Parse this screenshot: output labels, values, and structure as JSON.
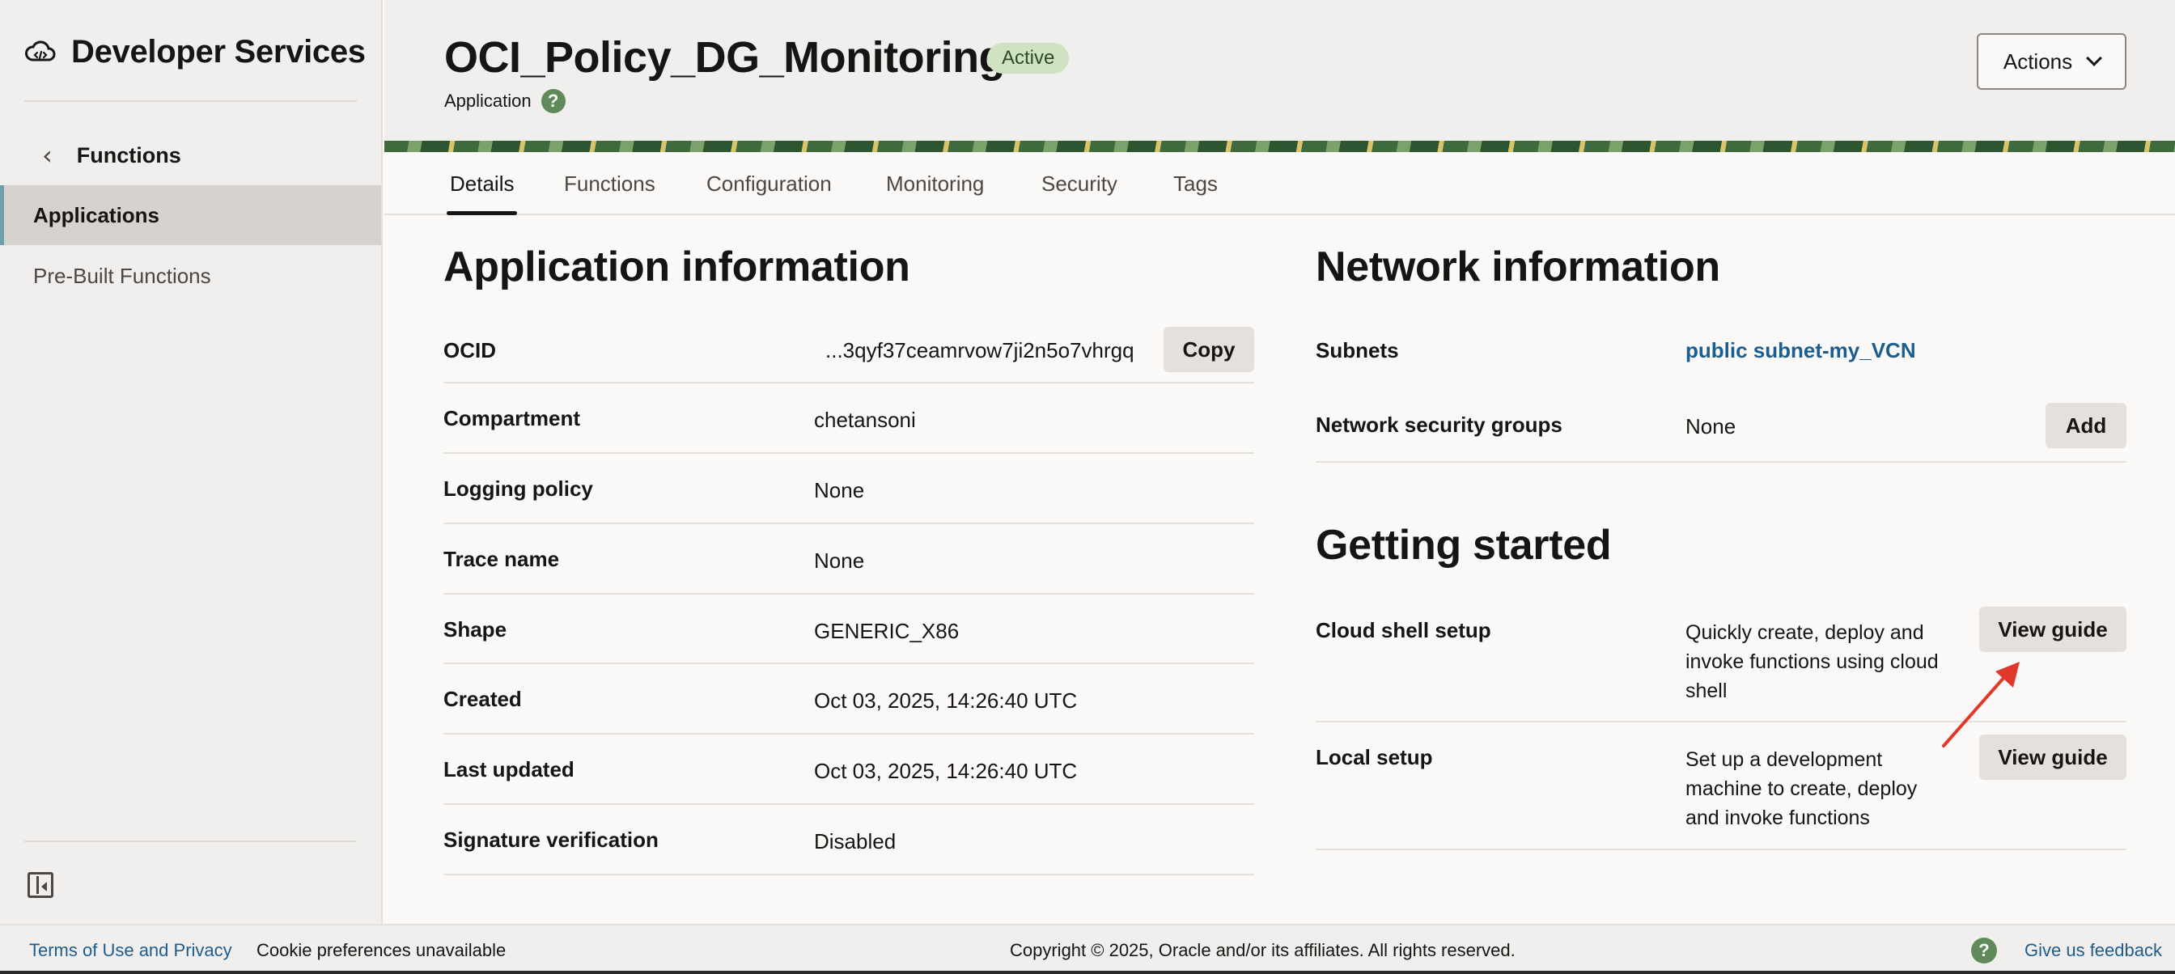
{
  "sidebar": {
    "brand_title": "Developer Services",
    "back_label": "Functions",
    "items": [
      {
        "label": "Applications",
        "selected": true
      },
      {
        "label": "Pre-Built Functions",
        "selected": false
      }
    ]
  },
  "header": {
    "title": "OCI_Policy_DG_Monitoring",
    "status": "Active",
    "subtitle": "Application",
    "help": "?",
    "actions_label": "Actions"
  },
  "tabs": [
    {
      "label": "Details",
      "active": true
    },
    {
      "label": "Functions",
      "active": false
    },
    {
      "label": "Configuration",
      "active": false
    },
    {
      "label": "Monitoring",
      "active": false
    },
    {
      "label": "Security",
      "active": false
    },
    {
      "label": "Tags",
      "active": false
    }
  ],
  "app_info": {
    "title": "Application information",
    "copy_label": "Copy",
    "rows": [
      {
        "label": "OCID",
        "value": "...3qyf37ceamrvow7ji2n5o7vhrgq"
      },
      {
        "label": "Compartment",
        "value": "chetansoni"
      },
      {
        "label": "Logging policy",
        "value": "None"
      },
      {
        "label": "Trace name",
        "value": "None"
      },
      {
        "label": "Shape",
        "value": "GENERIC_X86"
      },
      {
        "label": "Created",
        "value": "Oct 03, 2025, 14:26:40 UTC"
      },
      {
        "label": "Last updated",
        "value": "Oct 03, 2025, 14:26:40 UTC"
      },
      {
        "label": "Signature verification",
        "value": "Disabled"
      }
    ]
  },
  "network_info": {
    "title": "Network information",
    "subnets_label": "Subnets",
    "subnets_value": "public subnet-my_VCN",
    "nsg_label": "Network security groups",
    "nsg_value": "None",
    "add_label": "Add"
  },
  "getting_started": {
    "title": "Getting started",
    "items": [
      {
        "label": "Cloud shell setup",
        "lines": [
          "Quickly create, deploy and",
          "invoke functions using cloud",
          "shell"
        ],
        "button": "View guide"
      },
      {
        "label": "Local setup",
        "lines": [
          "Set up a development",
          "machine to create, deploy",
          "and invoke functions"
        ],
        "button": "View guide"
      }
    ]
  },
  "footer": {
    "terms": "Terms of Use and Privacy",
    "cookies": "Cookie preferences unavailable",
    "copyright": "Copyright © 2025, Oracle and/or its affiliates. All rights reserved.",
    "help": "?",
    "feedback": "Give us feedback"
  },
  "colors": {
    "accent_link": "#1c5d8f",
    "status_bg": "#cfe3c3",
    "annotation_arrow": "#e0392b"
  },
  "icons": [
    "cloud-code-icon",
    "chevron-left-icon",
    "help-icon",
    "chevron-down-icon",
    "collapse-sidebar-icon"
  ]
}
